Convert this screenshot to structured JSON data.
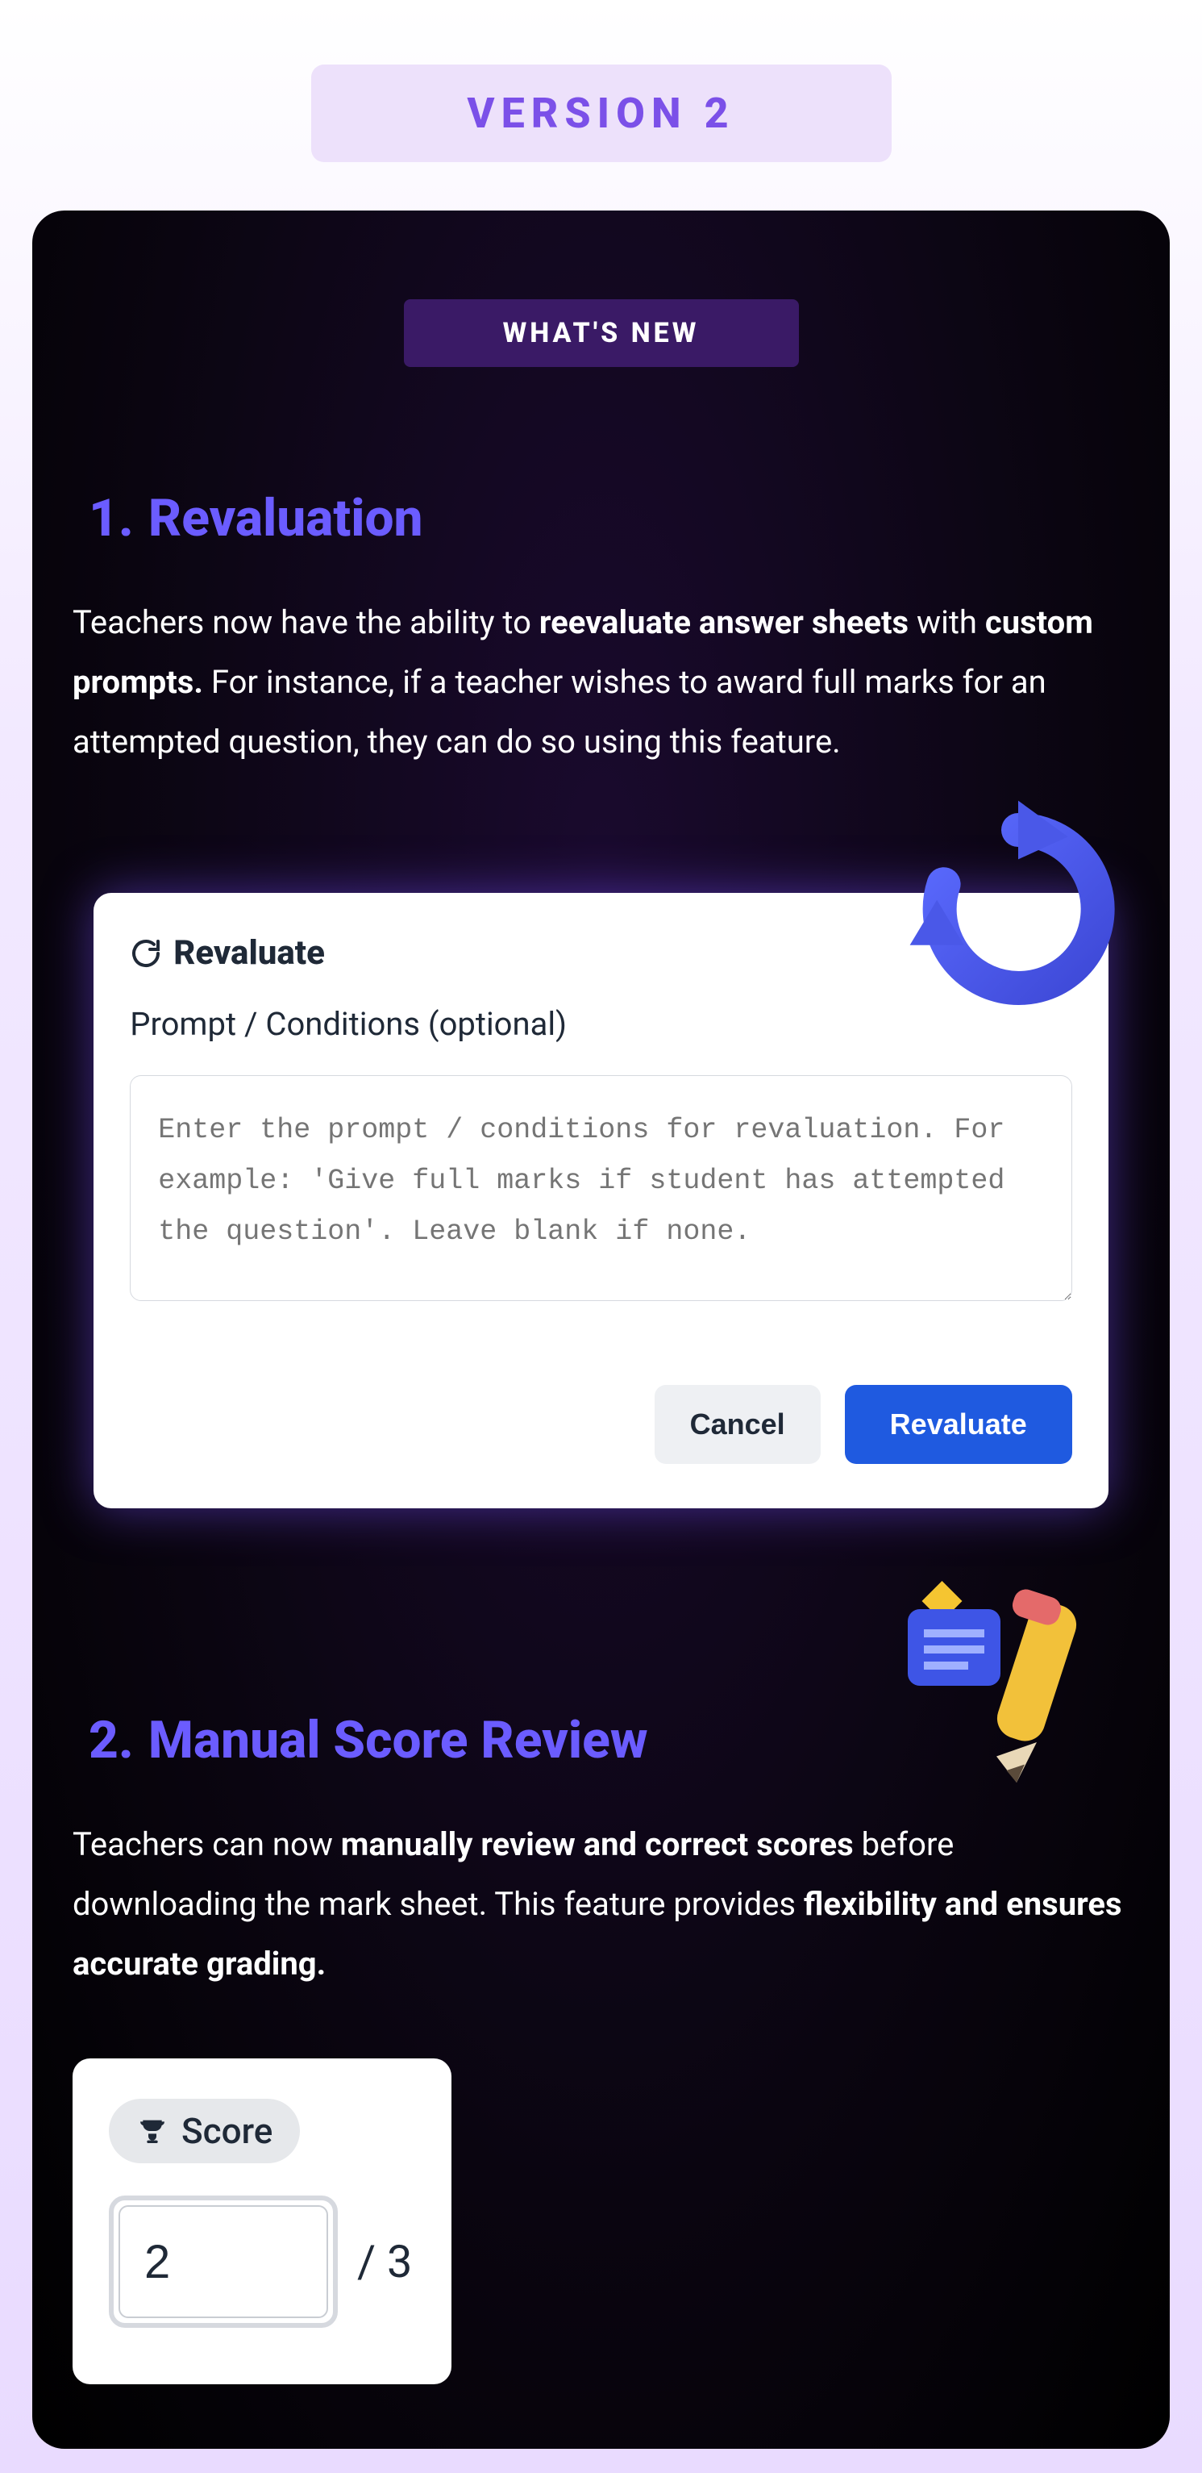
{
  "version_badge": "VERSION 2",
  "whats_new": "WHAT'S NEW",
  "section1": {
    "number": "1.",
    "title": "Revaluation",
    "para_lead": "Teachers now have the ability to ",
    "para_b1": "reevaluate answer sheets",
    "para_mid1": " with ",
    "para_b2": "custom prompts.",
    "para_tail": " For instance, if a teacher wishes to award full marks for an attempted question, they can do so using this feature."
  },
  "reval_panel": {
    "title": "Revaluate",
    "label": "Prompt / Conditions (optional)",
    "placeholder": "Enter the prompt / conditions for revaluation. For example: 'Give full marks if student has attempted the question'. Leave blank if none.",
    "cancel": "Cancel",
    "submit": "Revaluate"
  },
  "section2": {
    "number": "2.",
    "title": "Manual Score Review",
    "para_lead": "Teachers can now ",
    "para_b1": "manually review and correct scores",
    "para_mid1": " before downloading the mark sheet. This feature provides ",
    "para_b2": "flexibility and ensures accurate grading."
  },
  "score_panel": {
    "label": "Score",
    "value": "2",
    "denom": "/ 3"
  }
}
